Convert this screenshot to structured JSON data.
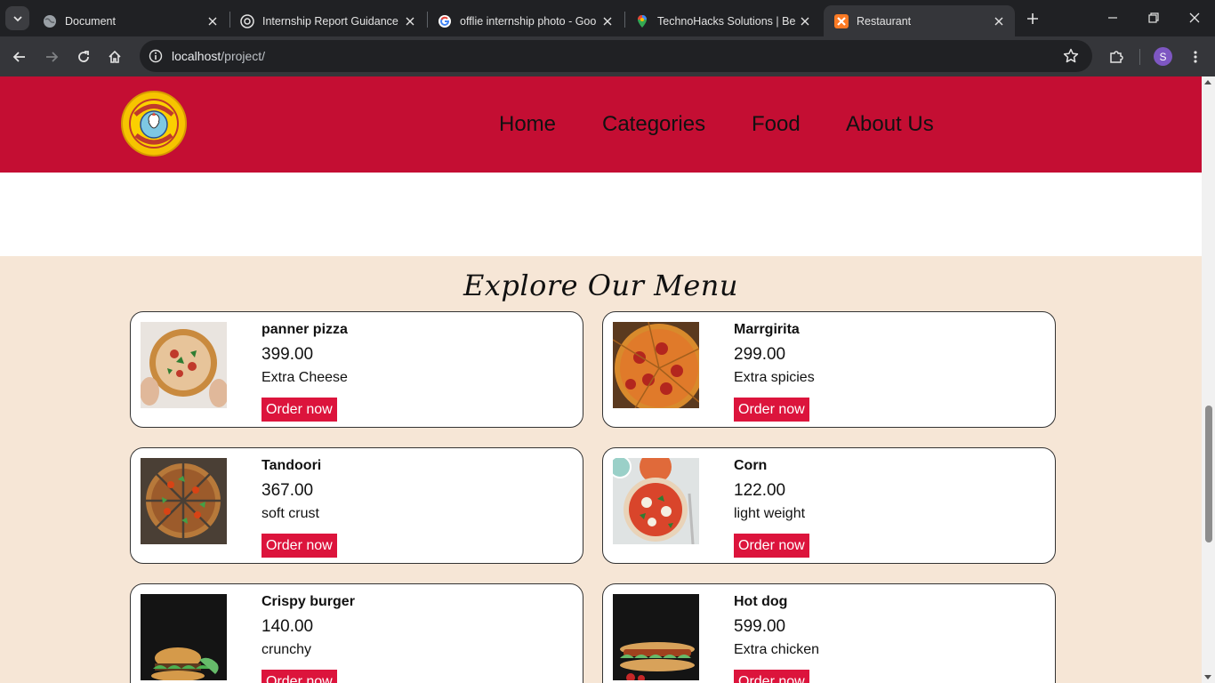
{
  "browser": {
    "tabs": [
      {
        "title": "Document",
        "favicon": "globe-icon"
      },
      {
        "title": "Internship Report Guidance",
        "favicon": "chatgpt-icon"
      },
      {
        "title": "offlie internship photo - Goo",
        "favicon": "google-icon"
      },
      {
        "title": "TechnoHacks Solutions | Bes",
        "favicon": "maps-pin-icon"
      },
      {
        "title": "Restaurant",
        "favicon": "xampp-icon",
        "active": true
      }
    ],
    "url_host": "localhost",
    "url_path": "/project/",
    "profile_initial": "S"
  },
  "site": {
    "nav": [
      "Home",
      "Categories",
      "Food",
      "About Us"
    ],
    "menu_title": "Explore Our Menu",
    "order_label": "Order now",
    "items": [
      {
        "name": "panner pizza",
        "price": "399.00",
        "desc": "Extra Cheese"
      },
      {
        "name": "Marrgirita",
        "price": "299.00",
        "desc": "Extra spicies"
      },
      {
        "name": "Tandoori",
        "price": "367.00",
        "desc": "soft crust"
      },
      {
        "name": "Corn",
        "price": "122.00",
        "desc": "light weight"
      },
      {
        "name": "Crispy burger",
        "price": "140.00",
        "desc": "crunchy"
      },
      {
        "name": "Hot dog",
        "price": "599.00",
        "desc": "Extra chicken"
      }
    ]
  },
  "colors": {
    "header_red": "#c40e33",
    "button_red": "#dc143c",
    "menu_bg": "#f6e6d6"
  }
}
